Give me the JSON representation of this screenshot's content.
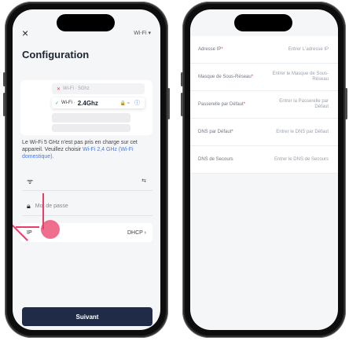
{
  "left_screen": {
    "close_icon": "×",
    "wifi_selector": "Wi-Fi ▾",
    "title": "Configuration",
    "options": [
      {
        "band": "Wi-Fi · 5Ghz"
      },
      {
        "prefix": "Wi-Fi · ",
        "band": "2.4Ghz",
        "signal": "🔒 ≈"
      }
    ],
    "notice_text": "Le Wi-Fi 5 GHz n'est pas pris en charge sur cet appareil. Veuillez choisir ",
    "notice_link": "Wi-Fi 2,4 GHz (Wi-Fi domestique).",
    "wifi_row_icon": "📶",
    "swap_icon": "⇆",
    "password_placeholder": "Mot de passe",
    "ip_label": "IP",
    "ip_mode": "DHCP",
    "ip_chevron": "›",
    "next_button": "Suivant",
    "accent": "#1f2b47",
    "highlight": "#e93e68"
  },
  "right_screen": {
    "fields": [
      {
        "label": "Adresse IP",
        "required": "*",
        "placeholder": "Entrer L'adresse IP"
      },
      {
        "label": "Masque de Sous-Réseau",
        "required": "*",
        "placeholder": "Entrer le Masque de Sous-Réseau"
      },
      {
        "label": "Passerelle par Défaut",
        "required": "*",
        "placeholder": "Entrer la Passerelle par Défaut"
      },
      {
        "label": "DNS par Défaut",
        "required": "*",
        "placeholder": "Entrer le DNS par Défaut"
      },
      {
        "label": "DNS de Secours",
        "required": "",
        "placeholder": "Entrer le DNS de Secours"
      }
    ]
  }
}
